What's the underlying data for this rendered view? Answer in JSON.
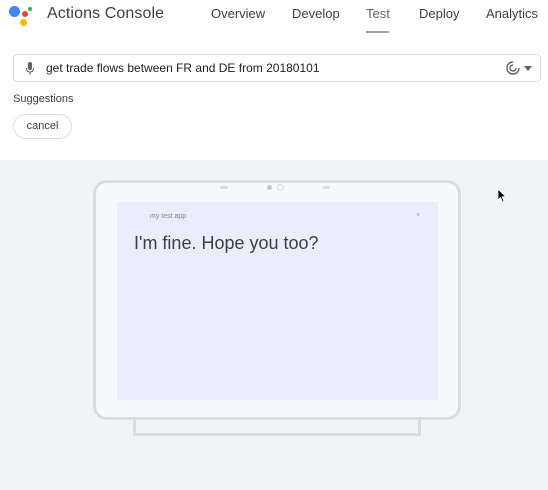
{
  "header": {
    "app_title": "Actions Console",
    "nav": [
      {
        "label": "Overview",
        "active": false
      },
      {
        "label": "Develop",
        "active": false
      },
      {
        "label": "Test",
        "active": true
      },
      {
        "label": "Deploy",
        "active": false
      },
      {
        "label": "Analytics",
        "active": false
      }
    ]
  },
  "query": {
    "value": "get trade flows between FR and DE from 20180101",
    "mic_icon": "mic-icon",
    "surface_icon": "smart-display-icon"
  },
  "suggestions": {
    "label": "Suggestions",
    "chips": [
      "cancel"
    ]
  },
  "simulator": {
    "app_name": "my test app",
    "close_glyph": "×",
    "message": "I'm fine. Hope you too?"
  },
  "colors": {
    "background": "#ffffff",
    "simulator_bg": "#f1f3f4",
    "screen_bg": "#e8eefb",
    "text": "#3c4043"
  }
}
